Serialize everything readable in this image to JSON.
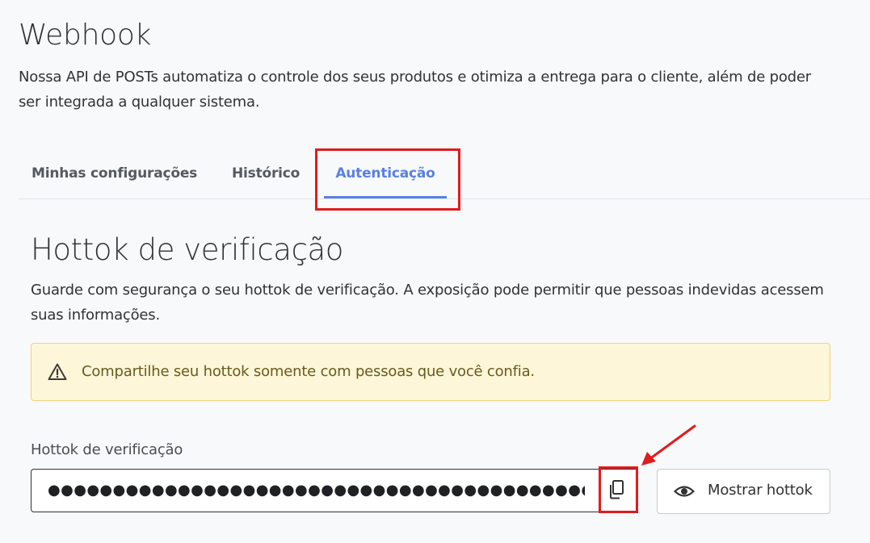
{
  "header": {
    "title": "Webhook",
    "description": "Nossa API de POSTs automatiza o controle dos seus produtos e otimiza a entrega para o cliente, além de poder ser integrada a qualquer sistema."
  },
  "tabs": [
    {
      "label": "Minhas configurações",
      "active": false
    },
    {
      "label": "Histórico",
      "active": false
    },
    {
      "label": "Autenticação",
      "active": true
    }
  ],
  "section": {
    "title": "Hottok de verificação",
    "description": "Guarde com segurança o seu hottok de verificação. A exposição pode permitir que pessoas indevidas acessem suas informações."
  },
  "alert": {
    "icon": "warning-triangle-icon",
    "text": "Compartilhe seu hottok somente com pessoas que você confia."
  },
  "hottok_field": {
    "label": "Hottok de verificação",
    "value": "●●●●●●●●●●●●●●●●●●●●●●●●●●●●●●●●●●●●●●●●●●●●●●●●●●●●●●●●●●●●●●●●",
    "copy_icon": "copy-icon"
  },
  "show_button": {
    "label": "Mostrar hottok",
    "icon": "eye-icon"
  },
  "colors": {
    "accent": "#5981e3",
    "annotation_red": "#e01c1c",
    "alert_bg": "#fdf6d8",
    "alert_border": "#f1d37c"
  }
}
